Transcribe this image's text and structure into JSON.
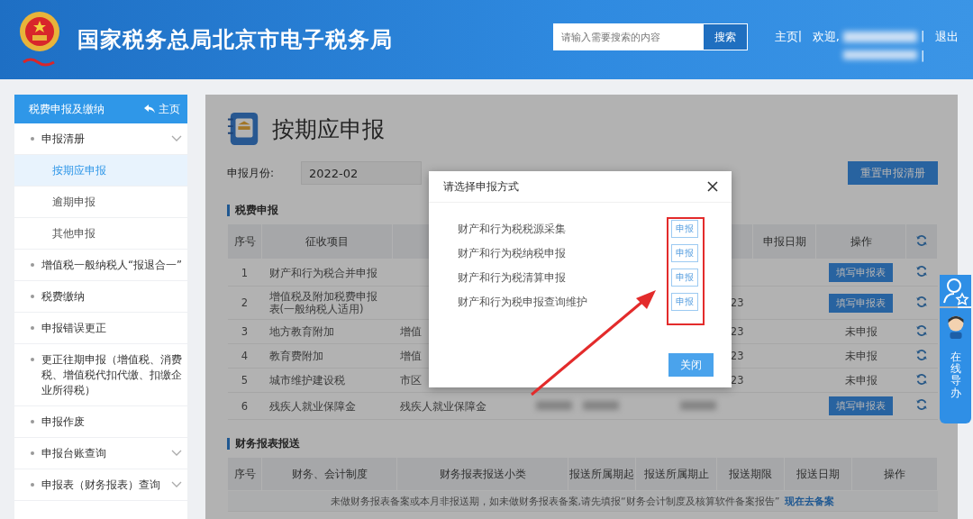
{
  "header": {
    "title": "国家税务总局北京市电子税务局",
    "search": {
      "placeholder": "请输入需要搜索的内容",
      "button": "搜索"
    },
    "home": "主页",
    "welcome": "欢迎,",
    "logout": "退出",
    "separators": [
      "|",
      "|",
      "|"
    ]
  },
  "sidebar": {
    "title": "税费申报及缴纳",
    "home_link": "主页",
    "items": [
      {
        "label": "申报清册",
        "expandable": true,
        "selected": false,
        "children": [
          {
            "label": "按期应申报",
            "selected": true
          },
          {
            "label": "逾期申报",
            "selected": false
          },
          {
            "label": "其他申报",
            "selected": false
          }
        ]
      },
      {
        "label": "增值税一般纳税人“报退合一”",
        "expandable": false,
        "selected": false
      },
      {
        "label": "税费缴纳",
        "expandable": false,
        "selected": false
      },
      {
        "label": "申报错误更正",
        "expandable": false,
        "selected": false
      },
      {
        "label": "更正往期申报（增值税、消费税、增值税代扣代缴、扣缴企业所得税）",
        "expandable": false,
        "selected": false
      },
      {
        "label": "申报作废",
        "expandable": false,
        "selected": false
      },
      {
        "label": "申报台账查询",
        "expandable": true,
        "selected": false
      },
      {
        "label": "申报表（财务报表）查询",
        "expandable": true,
        "selected": false
      }
    ]
  },
  "main": {
    "title": "按期应申报",
    "month_label": "申报月份:",
    "month_value": "2022-02",
    "reset_button": "重置申报清册",
    "tax_table": {
      "title": "税费申报",
      "columns": [
        {
          "label": "序号"
        },
        {
          "label": "征收项目"
        },
        {},
        {},
        {},
        {
          "label": "申报日期"
        },
        {
          "label": "操作"
        },
        {
          "kind": "refresh"
        }
      ],
      "rows": [
        {
          "no": "1",
          "item": "财产和行为税合并申报",
          "action": {
            "kind": "button",
            "text": "填写申报表"
          }
        },
        {
          "no": "2",
          "item": "增值税及附加税费申报表(一般纳税人适用)",
          "column_5": "23",
          "action": {
            "kind": "button",
            "text": "填写申报表"
          }
        },
        {
          "no": "3",
          "item": "地方教育附加",
          "column_3": "增值",
          "column_5": "23",
          "action": {
            "kind": "status",
            "text": "未申报"
          }
        },
        {
          "no": "4",
          "item": "教育费附加",
          "column_3": "增值",
          "column_5": "23",
          "action": {
            "kind": "status",
            "text": "未申报"
          }
        },
        {
          "no": "5",
          "item": "城市维护建设税",
          "column_3": "市区",
          "column_5": "23",
          "action": {
            "kind": "status",
            "text": "未申报"
          }
        },
        {
          "no": "6",
          "item": "残疾人就业保障金",
          "column_3": "残疾人就业保障金",
          "column_4": {
            "kind": "redacted"
          },
          "column_5": {
            "kind": "redacted"
          },
          "action": {
            "kind": "button",
            "text": "填写申报表"
          }
        }
      ]
    },
    "report_table": {
      "title": "财务报表报送",
      "columns": [
        "序号",
        "财务、会计制度",
        "财务报表报送小类",
        "报送所属期起",
        "报送所属期止",
        "报送期限",
        "报送日期",
        "操作"
      ],
      "notice": "未做财务报表备案或本月非报送期，如未做财务报表备案,请先填报“财务会计制度及核算软件备案报告”",
      "notice_link": "现在去备案"
    }
  },
  "dialog": {
    "title": "请选择申报方式",
    "options": [
      {
        "label": "财产和行为税税源采集",
        "button": "申报"
      },
      {
        "label": "财产和行为税纳税申报",
        "button": "申报"
      },
      {
        "label": "财产和行为税清算申报",
        "button": "申报"
      },
      {
        "label": "财产和行为税申报查询维护",
        "button": "申报"
      }
    ],
    "close_button": "关闭"
  },
  "assistant": {
    "label": "在线导办"
  }
}
